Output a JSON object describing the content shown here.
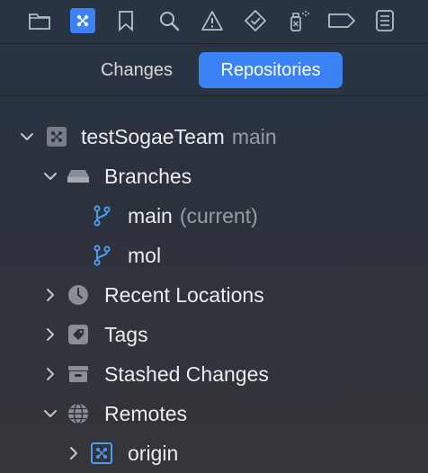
{
  "toolbar": {
    "icons": [
      {
        "name": "folder-icon"
      },
      {
        "name": "source-control-icon",
        "active": true
      },
      {
        "name": "bookmark-icon"
      },
      {
        "name": "search-icon"
      },
      {
        "name": "warning-icon"
      },
      {
        "name": "test-diamond-icon"
      },
      {
        "name": "debug-spray-icon"
      },
      {
        "name": "breakpoint-tag-icon"
      },
      {
        "name": "report-list-icon"
      }
    ]
  },
  "segmented": {
    "changes_label": "Changes",
    "repositories_label": "Repositories",
    "selected": "Repositories"
  },
  "tree": {
    "repo": {
      "name": "testSogaeTeam",
      "branch": "main",
      "expanded": true
    },
    "branches": {
      "label": "Branches",
      "expanded": true
    },
    "branch_items": [
      {
        "name": "main",
        "note": "(current)"
      },
      {
        "name": "mol",
        "note": ""
      }
    ],
    "recent_locations": {
      "label": "Recent Locations",
      "expanded": false
    },
    "tags": {
      "label": "Tags",
      "expanded": false
    },
    "stashed_changes": {
      "label": "Stashed Changes",
      "expanded": false
    },
    "remotes": {
      "label": "Remotes",
      "expanded": true
    },
    "remote_items": [
      {
        "name": "origin",
        "expanded": false
      }
    ]
  },
  "colors": {
    "accent": "#3b82f6",
    "branch_icon": "#4a9bf0",
    "background_top": "#283444",
    "background_bottom": "#35353a"
  }
}
